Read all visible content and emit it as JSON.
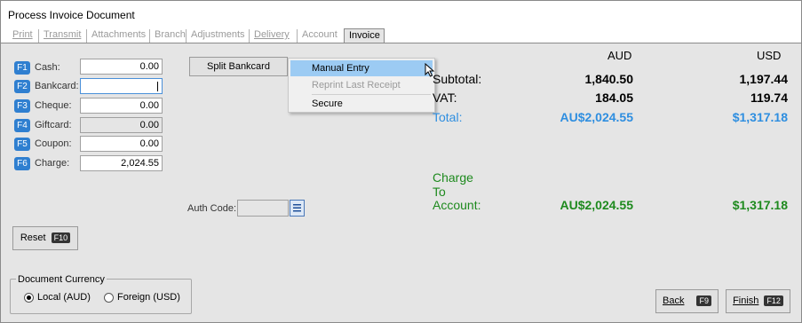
{
  "window": {
    "title": "Process Invoice Document"
  },
  "tabs": [
    {
      "label": "Print",
      "active": false
    },
    {
      "label": "Transmit",
      "active": false
    },
    {
      "label": "Attachments",
      "active": false
    },
    {
      "label": "Branch",
      "active": false
    },
    {
      "label": "Adjustments",
      "active": false
    },
    {
      "label": "Delivery",
      "active": false
    },
    {
      "label": "Account",
      "active": false
    },
    {
      "label": "Invoice",
      "active": true
    }
  ],
  "payments": [
    {
      "key": "F1",
      "label": "Cash:",
      "value": "0.00"
    },
    {
      "key": "F2",
      "label": "Bankcard:",
      "value": ""
    },
    {
      "key": "F3",
      "label": "Cheque:",
      "value": "0.00"
    },
    {
      "key": "F4",
      "label": "Giftcard:",
      "value": "0.00"
    },
    {
      "key": "F5",
      "label": "Coupon:",
      "value": "0.00"
    },
    {
      "key": "F6",
      "label": "Charge:",
      "value": "2,024.55"
    }
  ],
  "split_button": "Split Bankcard",
  "menu": {
    "items": [
      {
        "label": "Manual Entry",
        "state": "hover"
      },
      {
        "label": "Reprint Last Receipt",
        "state": "disabled"
      },
      {
        "label": "Secure",
        "state": "normal"
      }
    ]
  },
  "auth": {
    "label": "Auth Code:",
    "value": ""
  },
  "reset": {
    "label": "Reset",
    "key": "F10"
  },
  "totals": {
    "currency_aud": "AUD",
    "currency_usd": "USD",
    "subtotal": {
      "label": "Subtotal:",
      "aud": "1,840.50",
      "usd": "1,197.44"
    },
    "vat": {
      "label": "VAT:",
      "aud": "184.05",
      "usd": "119.74"
    },
    "total": {
      "label": "Total:",
      "aud": "AU$2,024.55",
      "usd": "$1,317.18"
    },
    "charge": {
      "label_line1": "Charge",
      "label_line2": "To",
      "label_line3": "Account:",
      "aud": "AU$2,024.55",
      "usd": "$1,317.18"
    }
  },
  "doc_currency": {
    "legend": "Document Currency",
    "local": "Local (AUD)",
    "foreign": "Foreign (USD)",
    "selected": "local"
  },
  "buttons": {
    "back": {
      "label": "Back",
      "key": "F9"
    },
    "finish": {
      "label": "Finish",
      "key": "F12"
    }
  },
  "colors": {
    "fkey_badge": "#2f7fd0",
    "total_blue": "#2e8ee0",
    "charge_green": "#1e8a1e",
    "menu_hover": "#9ccbf3"
  }
}
